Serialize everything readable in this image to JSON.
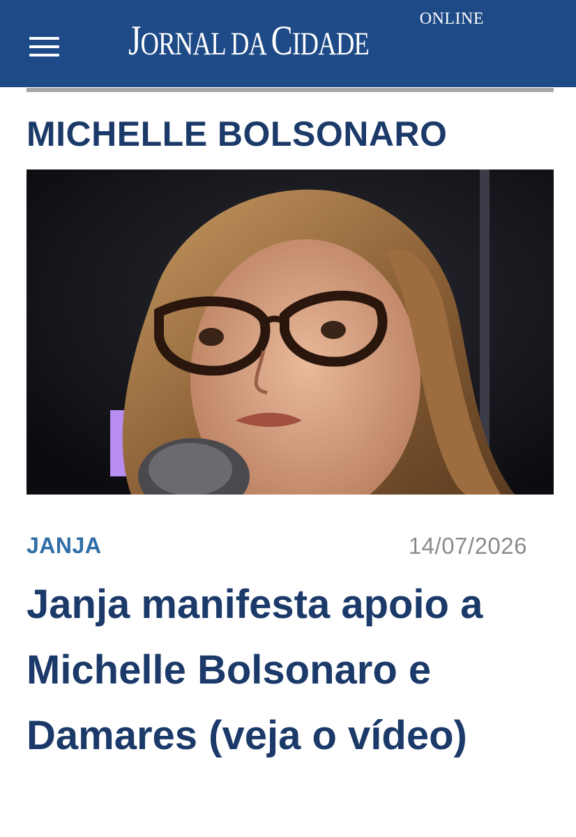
{
  "header": {
    "logo_online": "ONLINE",
    "logo_parts": [
      "J",
      "ORNAL",
      " DA ",
      "C",
      "IDADE"
    ],
    "menu_icon": "hamburger-menu-icon",
    "background_color": "#1e4a87"
  },
  "section": {
    "title": "MICHELLE BOLSONARO",
    "color": "#1b3a69"
  },
  "article": {
    "category": "JANJA",
    "date": "14/07/2026",
    "headline": "Janja manifesta apoio a Michelle Bolsonaro e Damares (veja o vídeo)",
    "category_color": "#2f6ea6"
  }
}
